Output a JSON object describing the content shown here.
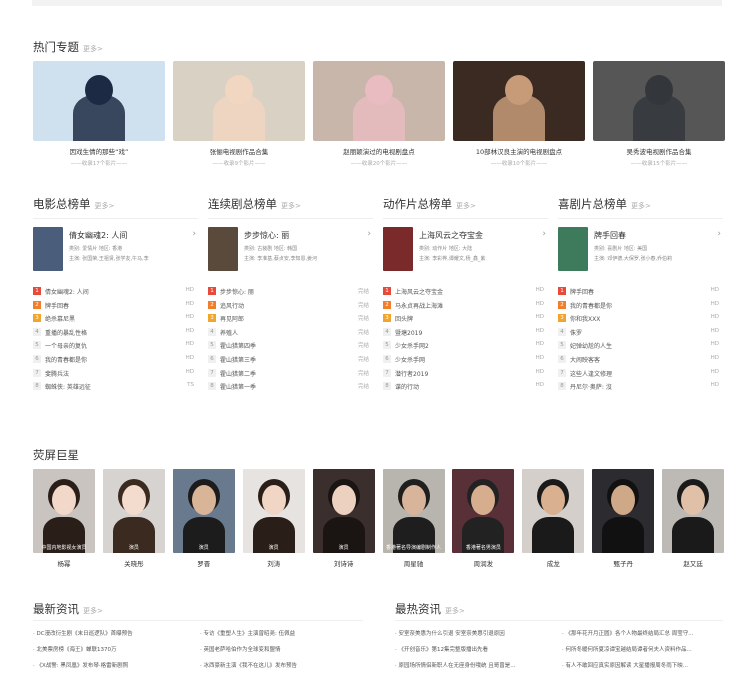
{
  "hot": {
    "title": "热门专题",
    "more": "更多>",
    "items": [
      {
        "title": "因戏生情的那些“戏”",
        "sub": "——收录17个影片——",
        "bg": "#cfe0ee",
        "sk": "#1d2a44"
      },
      {
        "title": "张俪电视剧作品合集",
        "sub": "——收录9个影片——",
        "bg": "#d9d2c4",
        "sk": "#f1d6c2"
      },
      {
        "title": "赵丽颖演过的电视剧盘点",
        "sub": "——收录20个影片——",
        "bg": "#c8b6aa",
        "sk": "#e8bcc0"
      },
      {
        "title": "10部林汉良主演的电视剧盘点",
        "sub": "——收录10个影片——",
        "bg": "#3a2a22",
        "sk": "#c79a78"
      },
      {
        "title": "吴秀波电视剧作品合集",
        "sub": "——收录15个影片——",
        "bg": "#565656",
        "sk": "#33363b"
      }
    ]
  },
  "ranks": [
    {
      "title": "电影总榜单",
      "more": "更多>",
      "feat": {
        "title": "倩女幽魂2: 人间",
        "meta": "类别: 爱情片  地区: 香港",
        "cast": "主演: 张国荣,王祖贤,张学友,午马,李",
        "poster": "#4a5d7a"
      },
      "items": [
        {
          "num": "1",
          "name": "倩女幽魂2: 人间",
          "status": "HD"
        },
        {
          "num": "2",
          "name": "牌手回春",
          "status": "HD"
        },
        {
          "num": "3",
          "name": "绝杀慕尼黑",
          "status": "HD"
        },
        {
          "num": "4",
          "name": "重播的暴乱性格",
          "status": "HD"
        },
        {
          "num": "5",
          "name": "一个母亲的复仇",
          "status": "HD"
        },
        {
          "num": "6",
          "name": "我的青春都是你",
          "status": "HD"
        },
        {
          "num": "7",
          "name": "斐腾兵法",
          "status": "HD"
        },
        {
          "num": "8",
          "name": "蜘蛛侠: 英雄远征",
          "status": "TS"
        }
      ]
    },
    {
      "title": "连续剧总榜单",
      "more": "更多>",
      "feat": {
        "title": "步步惊心: 丽",
        "meta": "类别: 古装剧  地区: 韩国",
        "cast": "主演: 李准基,蔡贞安,李知恩,姜河",
        "poster": "#5a4a3c"
      },
      "items": [
        {
          "num": "1",
          "name": "步步惊心: 丽",
          "status": "完结"
        },
        {
          "num": "2",
          "name": "追风行动",
          "status": "完结"
        },
        {
          "num": "3",
          "name": "再见阿郎",
          "status": "完结"
        },
        {
          "num": "4",
          "name": "养殖人",
          "status": "完结"
        },
        {
          "num": "5",
          "name": "霍山猎第四季",
          "status": "完结"
        },
        {
          "num": "6",
          "name": "霍山猎第三季",
          "status": "完结"
        },
        {
          "num": "7",
          "name": "霍山猎第二季",
          "status": "完结"
        },
        {
          "num": "8",
          "name": "霍山猎第一季",
          "status": "完结"
        }
      ]
    },
    {
      "title": "动作片总榜单",
      "more": "更多>",
      "feat": {
        "title": "上海风云之夺宝金",
        "meta": "类别: 动作片  地区: 大陆",
        "cast": "主演: 李彩桦,谭耀文,杨_鑫_紫",
        "poster": "#7a2a2a"
      },
      "items": [
        {
          "num": "1",
          "name": "上海风云之夺宝金",
          "status": "HD"
        },
        {
          "num": "2",
          "name": "马永贞再战上海滩",
          "status": "HD"
        },
        {
          "num": "3",
          "name": "回头牌",
          "status": "HD"
        },
        {
          "num": "4",
          "name": "暨塘2019",
          "status": "HD"
        },
        {
          "num": "5",
          "name": "少女杀手网2",
          "status": "HD"
        },
        {
          "num": "6",
          "name": "少女杀手网",
          "status": "HD"
        },
        {
          "num": "7",
          "name": "潜行者2019",
          "status": "HD"
        },
        {
          "num": "8",
          "name": "谍的行动",
          "status": "HD"
        }
      ]
    },
    {
      "title": "喜剧片总榜单",
      "more": "更多>",
      "feat": {
        "title": "牌手回春",
        "meta": "类别: 喜剧片  地区: 美国",
        "cast": "主演: 邓伊德,大保罗,张小春,乔伯莉",
        "poster": "#3e7a5c"
      },
      "items": [
        {
          "num": "1",
          "name": "牌手回春",
          "status": "HD"
        },
        {
          "num": "2",
          "name": "我的青春都是你",
          "status": "HD"
        },
        {
          "num": "3",
          "name": "你和我XXX",
          "status": "HD"
        },
        {
          "num": "4",
          "name": "侏罗",
          "status": "HD"
        },
        {
          "num": "5",
          "name": "妃弹幼尬的人生",
          "status": "HD"
        },
        {
          "num": "6",
          "name": "大闹映客客",
          "status": "HD"
        },
        {
          "num": "7",
          "name": "这些人逢文修理",
          "status": "HD"
        },
        {
          "num": "8",
          "name": "丹尼尔·奥萨: 沒",
          "status": "HD"
        }
      ]
    }
  ],
  "stars": {
    "title": "荧屏巨星",
    "items": [
      {
        "name": "杨幂",
        "cap": "中国内地影视女演员",
        "bg": "#c9c4c0",
        "hair": "#2a1e18",
        "sk": "#f1d8c8"
      },
      {
        "name": "关晓彤",
        "cap": "演员",
        "bg": "#d7d3d0",
        "hair": "#3a2a20",
        "sk": "#f3dccd"
      },
      {
        "name": "罗晋",
        "cap": "演员",
        "bg": "#6a7a8e",
        "hair": "#1c1c1c",
        "sk": "#d9b597"
      },
      {
        "name": "刘涛",
        "cap": "演员",
        "bg": "#e6e3e0",
        "hair": "#2a1e18",
        "sk": "#f1d6c5"
      },
      {
        "name": "刘诗诗",
        "cap": "演员",
        "bg": "#3a2f2c",
        "hair": "#1a1412",
        "sk": "#ecd1c0"
      },
      {
        "name": "周星驰",
        "cap": "香港著名导演编剧制作人",
        "bg": "#b8b4ae",
        "hair": "#1e1e1e",
        "sk": "#d8b49a"
      },
      {
        "name": "周润发",
        "cap": "香港著名男演员",
        "bg": "#5a3038",
        "hair": "#222222",
        "sk": "#d6ae8e"
      },
      {
        "name": "成龙",
        "cap": "",
        "bg": "#d4cfca",
        "hair": "#1a1a1a",
        "sk": "#d9b090"
      },
      {
        "name": "甄子丹",
        "cap": "",
        "bg": "#2c2c30",
        "hair": "#111111",
        "sk": "#cfa888"
      },
      {
        "name": "赵又廷",
        "cap": "",
        "bg": "#bdbab6",
        "hair": "#1a1a1a",
        "sk": "#e0c0a6"
      }
    ]
  },
  "news_latest": {
    "title": "最新资讯",
    "more": "更多>",
    "left": [
      "DC漫改衍生剧《末日巡逻队》首曝预告",
      "北美票房榜《海王》蝉联1370万",
      "《X战警: 黑凤凰》发布琴·格雷新剧照"
    ],
    "right": [
      "专访《重塑人生》主演曾昭尧: 伍佩益",
      "英国老萨哈伯作为全球变和盟情",
      "冰西豪新主演《我不在这儿》发布预告"
    ]
  },
  "news_hot": {
    "title": "最热资讯",
    "more": "更多>",
    "left": [
      "安室奈美惠为什么引退 安室奈美惠引退原因",
      "《开创音乐》第12集完整版播出先看",
      "原园场所情侣新职人在无座身份哦统 且哥曾是..."
    ],
    "right": [
      "《那年花开月正圆》各个人物最终结局汇总 周莹守...",
      "何所冬暖何所夏凉谭宝越结局谭者何夫人资料作品...",
      "有人不敢回应真实原因解读 大星播报周冬雨下映..."
    ]
  }
}
